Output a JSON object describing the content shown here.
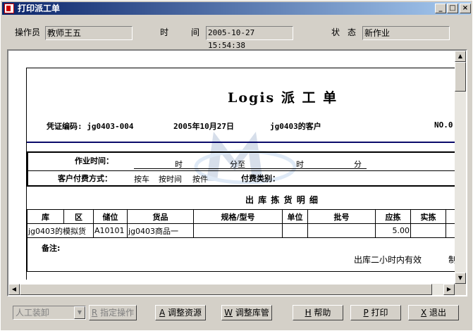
{
  "window": {
    "title": "打印派工单",
    "minimize": "_",
    "maximize": "□",
    "close": "×"
  },
  "header": {
    "operator_label": "操作员",
    "operator_value": "教师王五",
    "time_label_1": "时",
    "time_label_2": "间",
    "time_value": "2005-10-27 15:54:38",
    "status_label_1": "状",
    "status_label_2": "态",
    "status_value": "新作业"
  },
  "document": {
    "title": "Logis 派 工 单",
    "voucher": "凭证编码: jg0403-004",
    "date": "2005年10月27日",
    "customer": "jg0403的客户",
    "no": "NO.0",
    "work_time_label": "作业时间：",
    "hour1": "时",
    "minute_to": "分至",
    "hour2": "时",
    "minute2": "分",
    "pay_method_label": "客户付费方式：",
    "pay_opt1": "按车",
    "pay_opt2": "按时间",
    "pay_opt3": "按件",
    "fee_type_label": "付费类别：",
    "detail_title": "出 库 拣 货 明 细",
    "columns": [
      "库",
      "区",
      "储位",
      "货品",
      "规格/型号",
      "单位",
      "批号",
      "应拣",
      "实拣"
    ],
    "rows": [
      [
        "jg0403的模拟货",
        "A10101",
        "jg0403商品一",
        "",
        "",
        "",
        "5.00",
        ""
      ]
    ],
    "remark_label": "备注:",
    "valid_note": "出库二小时内有效",
    "trailing_text": "制"
  },
  "toolbar": {
    "mode_combo": "人工装卸",
    "assign_key": "R",
    "assign_label": "指定操作",
    "adjust_res_key": "A",
    "adjust_res_label": "调整资源",
    "adjust_stock_key": "W",
    "adjust_stock_label": "调整库管",
    "help_key": "H",
    "help_label": "帮助",
    "print_key": "P",
    "print_label": "打印",
    "exit_key": "X",
    "exit_label": "退出"
  }
}
